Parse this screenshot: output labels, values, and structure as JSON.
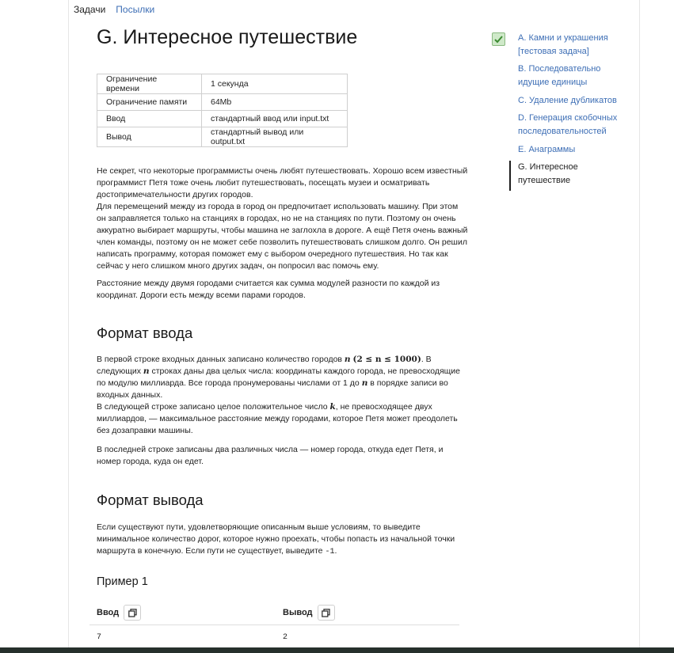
{
  "nav": {
    "tasks": "Задачи",
    "submissions": "Посылки"
  },
  "title": "G. Интересное путешествие",
  "limits": [
    {
      "key": "Ограничение времени",
      "value": "1 секунда"
    },
    {
      "key": "Ограничение памяти",
      "value": "64Mb"
    },
    {
      "key": "Ввод",
      "value": "стандартный ввод или input.txt"
    },
    {
      "key": "Вывод",
      "value": "стандартный вывод или output.txt"
    }
  ],
  "statement": {
    "p1_l1": "Не секрет, что некоторые программисты очень любят путешествовать. Хорошо всем известный",
    "p1_l2": "программист Петя тоже очень любит путешествовать, посещать музеи и осматривать",
    "p1_l3": "достопримечательности других городов.",
    "p1_l4": "Для перемещений между из города в город он предпочитает использовать машину. При этом",
    "p1_l5": "он заправляется только на станциях в городах, но не на станциях по пути. Поэтому он очень",
    "p1_l6": "аккуратно выбирает маршруты, чтобы машина не заглохла в дороге. А ещё Петя очень важный",
    "p1_l7": "член команды, поэтому он не может себе позволить путешествовать слишком долго. Он решил",
    "p1_l8": "написать программу, которая поможет ему с выбором очередного путешествия. Но так как",
    "p1_l9": "сейчас у него слишком много других задач, он попросил вас помочь ему.",
    "p2_l1": "Расстояние между двумя городами считается как сумма модулей разности по каждой из",
    "p2_l2": "координат. Дороги есть между всеми парами городов."
  },
  "input_format": {
    "heading": "Формат ввода",
    "l1a": "В первой строке входных данных записано количество городов",
    "l1_math_n": "n",
    "l1_math_range": "(2 ≤ n ≤ 1000)",
    "l1b": ". В",
    "l2a": "следующих",
    "l2_math": "n",
    "l2b": "строках даны два целых числа: координаты каждого города, не превосходящие",
    "l3a": "по модулю миллиарда. Все города пронумерованы числами от 1 до",
    "l3_math": "n",
    "l3b": "в порядке записи во",
    "l4": "входных данных.",
    "l5a": "В следующей строке записано целое положительное число",
    "l5_math": "k",
    "l5b": ", не превосходящее двух",
    "l6": "миллиардов, — максимальное расстояние между городами, которое Петя может преодолеть",
    "l7": "без дозаправки машины.",
    "p2_l1": "В последней строке записаны два различных числа — номер города, откуда едет Петя, и",
    "p2_l2": "номер города, куда он едет."
  },
  "output_format": {
    "heading": "Формат вывода",
    "l1": "Если существуют пути, удовлетворяющие описанным выше условиям, то выведите",
    "l2": "минимальное количество дорог, которое нужно проехать, чтобы попасть из начальной точки",
    "l3a": "маршрута в конечную. Если пути не существует, выведите",
    "l3_code": "-1",
    "l3b": "."
  },
  "example": {
    "title": "Пример 1",
    "input_label": "Ввод",
    "output_label": "Вывод",
    "input_value": "7",
    "output_value": "2"
  },
  "sidebar": {
    "items": [
      {
        "line1": "A. Камни и украшения",
        "line2": "[тестовая задача]"
      },
      {
        "line1": "B. Последовательно",
        "line2": "идущие единицы"
      },
      {
        "line1": "C. Удаление дубликатов",
        "line2": ""
      },
      {
        "line1": "D. Генерация скобочных",
        "line2": "последовательностей"
      },
      {
        "line1": "E. Анаграммы",
        "line2": ""
      },
      {
        "line1": "G. Интересное",
        "line2": "путешествие"
      }
    ]
  },
  "colors": {
    "link": "#3d6eb5",
    "check_bg": "#cfe9c9",
    "check_mark": "#3c8a32",
    "bottom_bar": "#26302c"
  }
}
